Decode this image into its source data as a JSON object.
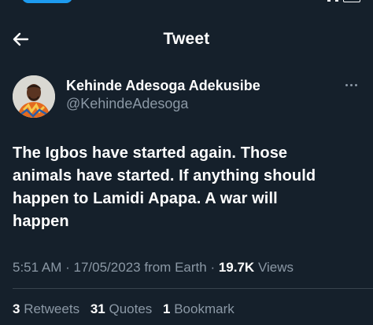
{
  "header": {
    "title": "Tweet",
    "back_icon": "arrow-left-icon"
  },
  "author": {
    "display_name": "Kehinde Adesoga Adekusibe",
    "handle": "@KehindeAdesoga",
    "more_icon": "more-horizontal-icon"
  },
  "tweet": {
    "lines": [
      "The Igbos have started again. Those",
      "animals have started. If anything should",
      "happen to Lamidi Apapa. A war will",
      "happen"
    ]
  },
  "meta": {
    "time": "5:51 AM",
    "separator": "·",
    "date": "17/05/2023",
    "source": "from Earth",
    "views_count": "19.7K",
    "views_label": "Views"
  },
  "stats": {
    "retweets_count": "3",
    "retweets_label": "Retweets",
    "quotes_count": "31",
    "quotes_label": "Quotes",
    "bookmarks_count": "1",
    "bookmarks_label": "Bookmark"
  },
  "colors": {
    "background": "#15202b",
    "text_primary": "#ffffff",
    "text_secondary": "#8b98a5",
    "accent": "#1d9bf0",
    "divider": "#38444d"
  }
}
